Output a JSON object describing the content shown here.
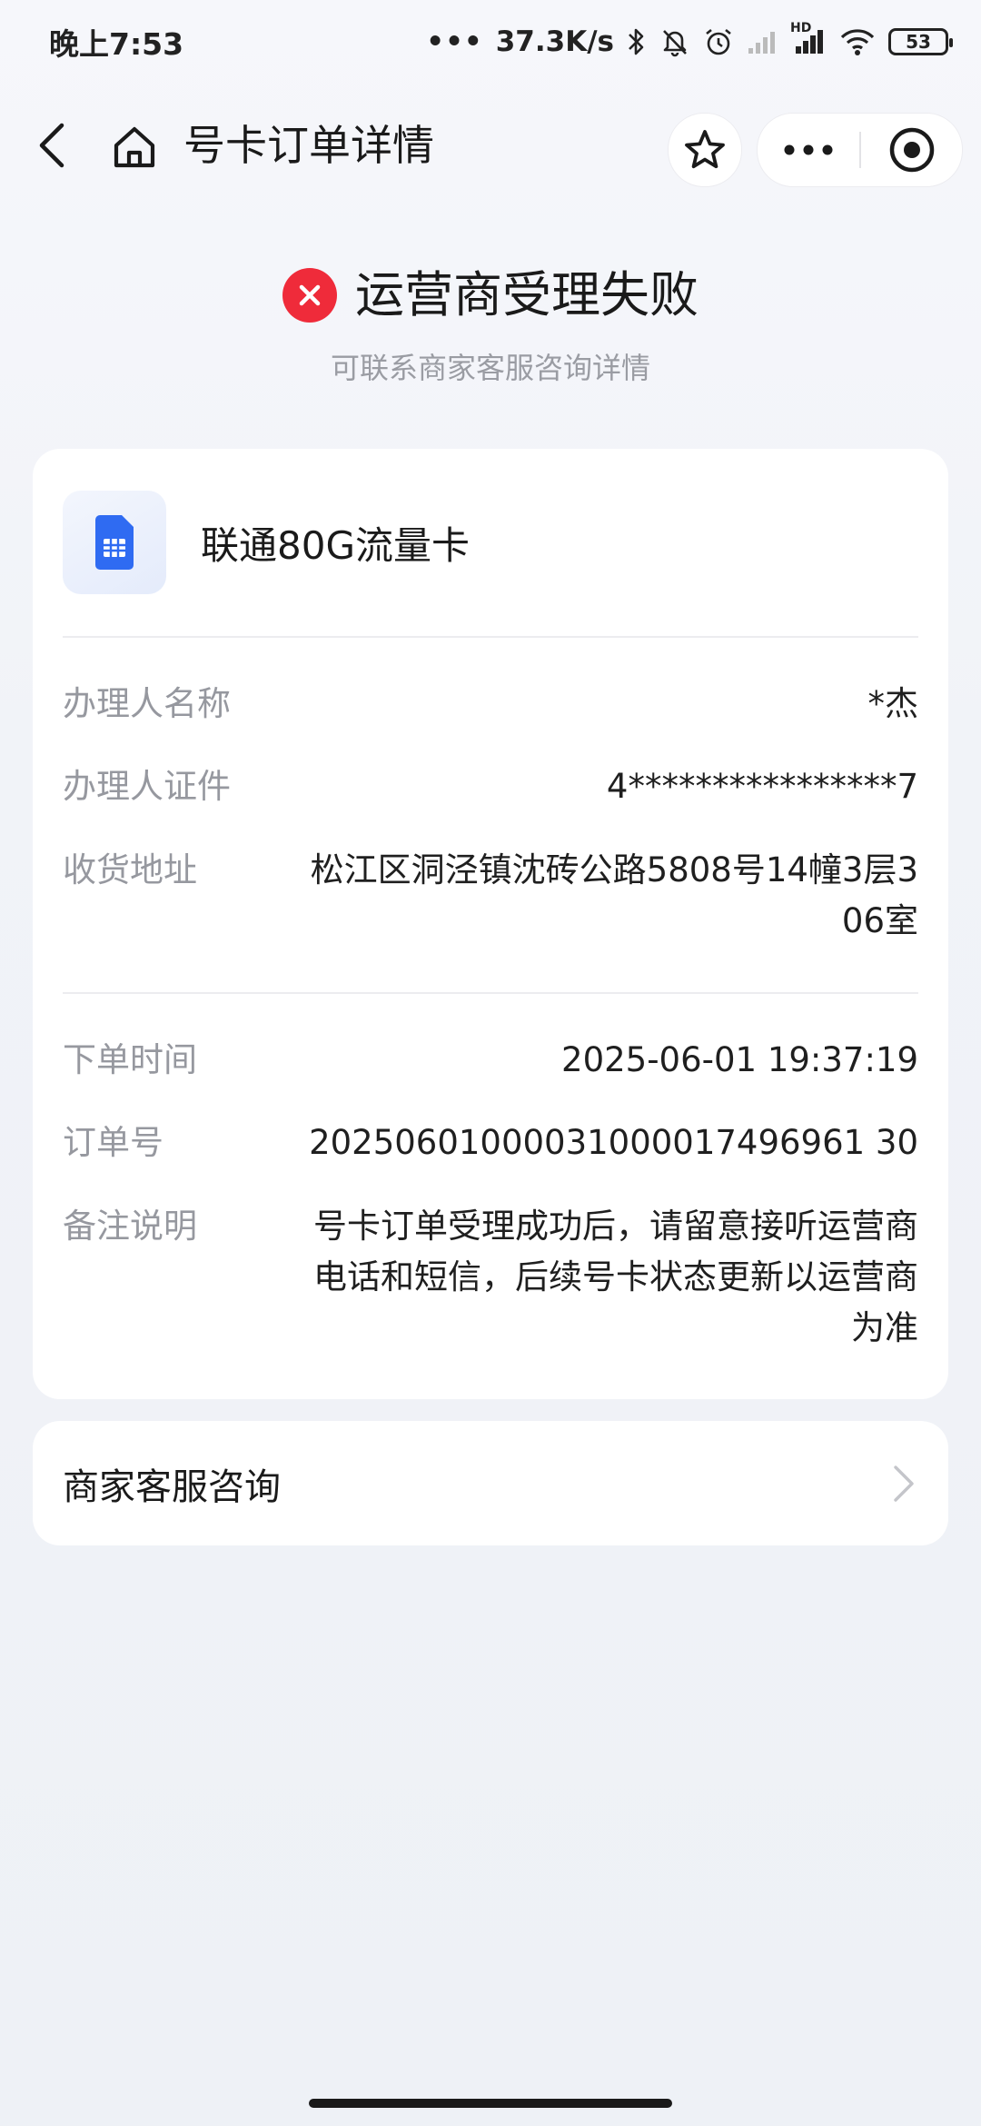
{
  "status_bar": {
    "time": "晚上7:53",
    "network_speed": "37.3K/s",
    "battery": "53",
    "hd_label": "HD"
  },
  "nav": {
    "title": "号卡订单详情",
    "icons": {
      "back": "chevron-left-icon",
      "home": "home-icon",
      "star": "star-icon",
      "more": "more-dots-icon",
      "close": "target-close-icon"
    }
  },
  "order_status": {
    "title": "运营商受理失败",
    "subtitle": "可联系商家客服咨询详情",
    "icon": "fail-x-icon",
    "color": "#ef2b3a"
  },
  "product": {
    "name": "联通80G流量卡",
    "icon": "sim-card-icon",
    "accent": "#2f6bf2"
  },
  "applicant": {
    "name_label": "办理人名称",
    "name_value": "*杰",
    "id_label": "办理人证件",
    "id_value": "4****************7",
    "address_label": "收货地址",
    "address_value": "松江区洞泾镇沈砖公路5808号14幢3层306室"
  },
  "order": {
    "time_label": "下单时间",
    "time_value": "2025-06-01 19:37:19",
    "number_label": "订单号",
    "number_value": "20250601000031000017496961 30",
    "remark_label": "备注说明",
    "remark_value": "号卡订单受理成功后，请留意接听运营商电话和短信，后续号卡状态更新以运营商为准"
  },
  "service": {
    "label": "商家客服咨询",
    "icon": "chevron-right-icon"
  }
}
